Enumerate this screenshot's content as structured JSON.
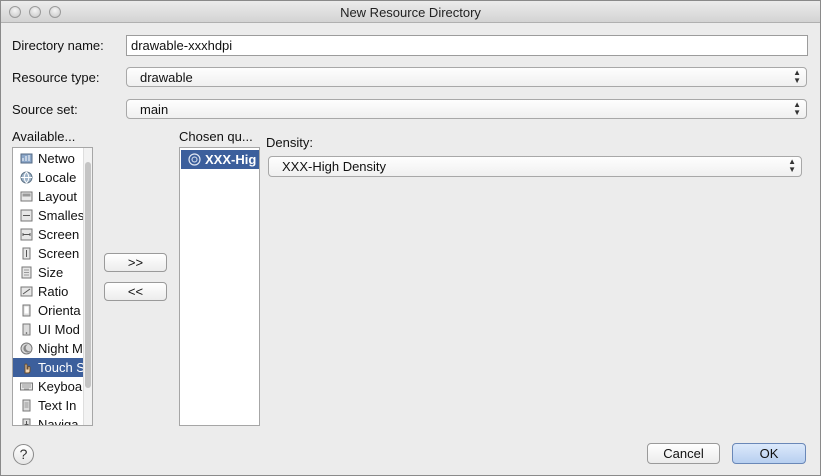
{
  "window": {
    "title": "New Resource Directory"
  },
  "form": {
    "directory_name_label": "Directory name:",
    "directory_name_value": "drawable-xxxhdpi",
    "resource_type_label": "Resource type:",
    "resource_type_value": "drawable",
    "source_set_label": "Source set:",
    "source_set_value": "main"
  },
  "available": {
    "header": "Available...",
    "items": [
      {
        "label": "Netwo",
        "icon": "network-icon"
      },
      {
        "label": "Locale",
        "icon": "globe-icon"
      },
      {
        "label": "Layout",
        "icon": "layout-icon"
      },
      {
        "label": "Smalles",
        "icon": "smallest-width-icon"
      },
      {
        "label": "Screen",
        "icon": "screen-width-icon"
      },
      {
        "label": "Screen",
        "icon": "screen-height-icon"
      },
      {
        "label": "Size",
        "icon": "size-icon"
      },
      {
        "label": "Ratio",
        "icon": "ratio-icon"
      },
      {
        "label": "Orienta",
        "icon": "orientation-icon"
      },
      {
        "label": "UI Mod",
        "icon": "ui-mode-icon"
      },
      {
        "label": "Night M",
        "icon": "night-mode-icon"
      },
      {
        "label": "Touch S",
        "icon": "touch-icon"
      },
      {
        "label": "Keyboa",
        "icon": "keyboard-icon"
      },
      {
        "label": "Text In",
        "icon": "text-input-icon"
      },
      {
        "label": "Naviga",
        "icon": "navigation-icon"
      }
    ],
    "selected_index": 11
  },
  "transfer": {
    "add_label": ">>",
    "remove_label": "<<"
  },
  "chosen": {
    "header": "Chosen qu...",
    "items": [
      {
        "label": "XXX-Hig",
        "icon": "density-icon"
      }
    ]
  },
  "density": {
    "label": "Density:",
    "value": "XXX-High Density"
  },
  "footer": {
    "help_label": "?",
    "cancel_label": "Cancel",
    "ok_label": "OK"
  },
  "colors": {
    "selection": "#3c5f9c",
    "window_bg": "#ececec"
  }
}
